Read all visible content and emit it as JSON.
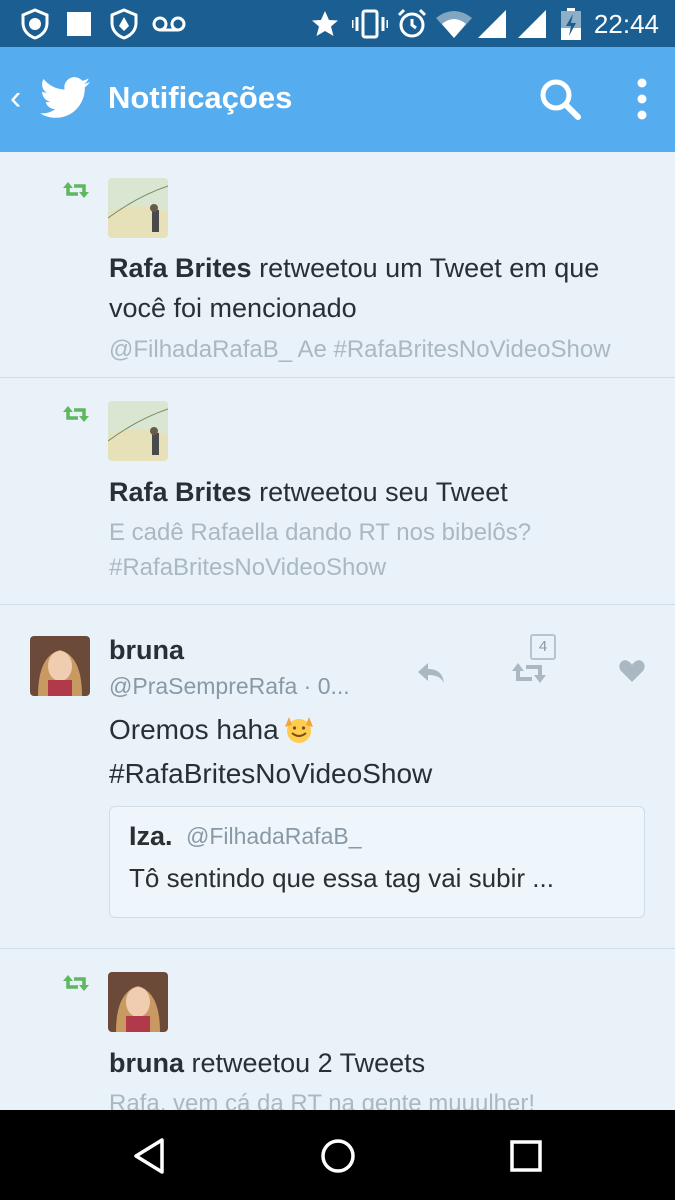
{
  "status_bar": {
    "time": "22:44",
    "icons": [
      "shield-badge-icon",
      "square-icon",
      "vpn-shield-icon",
      "voicemail-icon",
      "star-icon",
      "vibrate-icon",
      "alarm-icon",
      "wifi-icon",
      "signal-icon",
      "signal-icon",
      "battery-charging-icon"
    ]
  },
  "app_bar": {
    "title": "Notificações",
    "icons": [
      "back-chevron-icon",
      "twitter-bird-icon",
      "search-icon",
      "more-vertical-icon"
    ]
  },
  "notifications": [
    {
      "type": "retweet",
      "user": "Rafa Brites",
      "action": "retweetou um Tweet em que você foi mencionado",
      "preview": "@FilhadaRafaB_ Ae #RafaBritesNoVideoShow"
    },
    {
      "type": "retweet",
      "user": "Rafa Brites",
      "action": "retweetou seu Tweet",
      "preview": "E cadê Rafaella dando RT nos bibelôs? #RafaBritesNoVideoShow"
    },
    {
      "type": "tweet",
      "name": "bruna",
      "handle": "@PraSempreRafa · 0...",
      "body_line1": "Oremos haha",
      "body_line2": "#RafaBritesNoVideoShow",
      "retweet_count": "4",
      "quote": {
        "name": "Iza.",
        "handle": "@FilhadaRafaB_",
        "text": "Tô sentindo que essa tag vai subir ..."
      }
    },
    {
      "type": "retweet",
      "user": "bruna",
      "action": "retweetou 2 Tweets",
      "preview": "Rafa, vem cá da RT na gente muuulher!"
    }
  ],
  "nav_bar": {
    "icons": [
      "back-triangle-icon",
      "home-circle-icon",
      "recents-square-icon"
    ]
  },
  "colors": {
    "status_bar": "#1b5e91",
    "app_bar": "#55acee",
    "background": "#e9f2f9",
    "retweet_green": "#5fb760",
    "text": "#292f33",
    "muted": "#aab8c2"
  }
}
